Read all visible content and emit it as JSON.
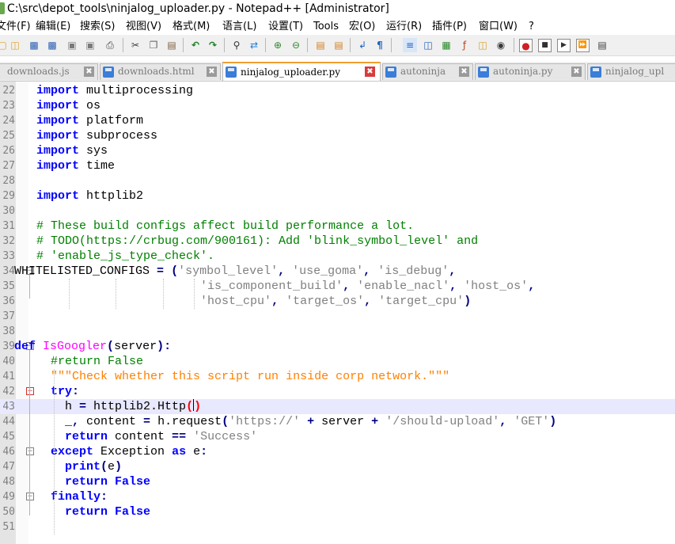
{
  "window": {
    "title": "C:\\src\\depot_tools\\ninjalog_uploader.py - Notepad++ [Administrator]"
  },
  "menu": [
    "文件(F)",
    "编辑(E)",
    "搜索(S)",
    "视图(V)",
    "格式(M)",
    "语言(L)",
    "设置(T)",
    "Tools",
    "宏(O)",
    "运行(R)",
    "插件(P)",
    "窗口(W)",
    "?"
  ],
  "toolbar": {
    "icons": [
      "new-file-icon",
      "open-file-icon",
      "save-icon",
      "save-all-icon",
      "close-icon",
      "close-all-icon",
      "print-icon",
      "cut-icon",
      "copy-icon",
      "paste-icon",
      "undo-icon",
      "redo-icon",
      "find-icon",
      "replace-icon",
      "zoom-in-icon",
      "zoom-out-icon",
      "sync-vertical-icon",
      "sync-horizontal-icon",
      "word-wrap-icon",
      "show-all-chars-icon",
      "indent-guide-icon",
      "user-defined-language-icon",
      "document-map-icon",
      "function-list-icon",
      "folder-as-workspace-icon",
      "monitor-icon",
      "record-macro-icon",
      "stop-record-icon",
      "play-macro-icon",
      "run-macro-multiple-icon",
      "save-macro-icon"
    ]
  },
  "tabs": [
    {
      "label": "downloads.js",
      "active": false
    },
    {
      "label": "downloads.html",
      "active": false
    },
    {
      "label": "ninjalog_uploader.py",
      "active": true
    },
    {
      "label": "autoninja",
      "active": false
    },
    {
      "label": "autoninja.py",
      "active": false
    },
    {
      "label": "ninjalog_upl",
      "active": false
    }
  ],
  "colors": {
    "keyword": "#0000ff",
    "comment": "#008000",
    "string": "#808080",
    "docstring": "#ff8000",
    "function_name": "#ff00ff",
    "active_tab_accent": "#f0a030",
    "current_line": "#e8e8ff"
  },
  "editor": {
    "current_line": 43,
    "lines": [
      {
        "n": "22",
        "code": "import multiprocessing"
      },
      {
        "n": "23",
        "code": "import os"
      },
      {
        "n": "24",
        "code": "import platform"
      },
      {
        "n": "25",
        "code": "import subprocess"
      },
      {
        "n": "26",
        "code": "import sys"
      },
      {
        "n": "27",
        "code": "import time"
      },
      {
        "n": "28",
        "code": ""
      },
      {
        "n": "29",
        "code": "import httplib2"
      },
      {
        "n": "30",
        "code": ""
      },
      {
        "n": "31",
        "code": "# These build configs affect build performance a lot."
      },
      {
        "n": "32",
        "code": "# TODO(https://crbug.com/900161): Add 'blink_symbol_level' and"
      },
      {
        "n": "33",
        "code": "# 'enable_js_type_check'."
      },
      {
        "n": "34",
        "code": "WHITELISTED_CONFIGS = ('symbol_level', 'use_goma', 'is_debug',"
      },
      {
        "n": "35",
        "code": "                       'is_component_build', 'enable_nacl', 'host_os',"
      },
      {
        "n": "36",
        "code": "                       'host_cpu', 'target_os', 'target_cpu')"
      },
      {
        "n": "37",
        "code": ""
      },
      {
        "n": "38",
        "code": ""
      },
      {
        "n": "39",
        "code": "def IsGoogler(server):"
      },
      {
        "n": "40",
        "code": "  #return False"
      },
      {
        "n": "41",
        "code": "  \"\"\"Check whether this script run inside corp network.\"\"\""
      },
      {
        "n": "42",
        "code": "  try:"
      },
      {
        "n": "43",
        "code": "    h = httplib2.Http()"
      },
      {
        "n": "44",
        "code": "    _, content = h.request('https://' + server + '/should-upload', 'GET')"
      },
      {
        "n": "45",
        "code": "    return content == 'Success'"
      },
      {
        "n": "46",
        "code": "  except Exception as e:"
      },
      {
        "n": "47",
        "code": "    print(e)"
      },
      {
        "n": "48",
        "code": "    return False"
      },
      {
        "n": "49",
        "code": "  finally:"
      },
      {
        "n": "50",
        "code": "    return False"
      },
      {
        "n": "51",
        "code": ""
      }
    ]
  }
}
